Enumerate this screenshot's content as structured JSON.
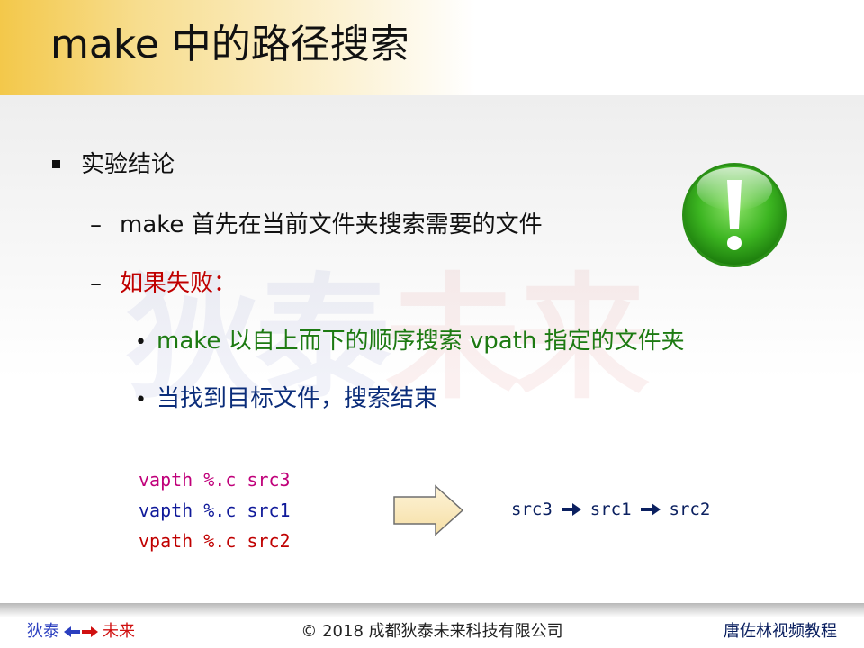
{
  "slide": {
    "title": "make 中的路径搜索",
    "watermark_left": "狄泰",
    "watermark_right": "未来"
  },
  "bullets": {
    "b1": "实验结论",
    "b1_1": "make 首先在当前文件夹搜索需要的文件",
    "b1_2": "如果失败：",
    "b1_2_1": "make 以自上而下的顺序搜索 vpath 指定的文件夹",
    "b1_2_2": "当找到目标文件，搜索结束"
  },
  "code": {
    "line1": "vapth %.c src3",
    "line2": "vapth %.c src1",
    "line3": "vpath %.c src2"
  },
  "search_order": {
    "step1": "src3",
    "step2": "src1",
    "step3": "src2"
  },
  "footer": {
    "brand_left": "狄泰",
    "brand_right": "未来",
    "copyright": "© 2018 成都狄泰未来科技有限公司",
    "course": "唐佐林视频教程"
  },
  "colors": {
    "title_gold": "#f3c84a",
    "green_text": "#1d7a12",
    "red_text": "#c00000",
    "magenta_code": "#c0007a",
    "navy_code": "#101a9a",
    "check_green": "#3cb521"
  },
  "icons": {
    "checkmark": "exclamation-badge-icon",
    "flow_arrow": "right-block-arrow-icon",
    "chain_arrow": "right-arrow-icon",
    "brand_arrow": "double-arrow-icon"
  }
}
